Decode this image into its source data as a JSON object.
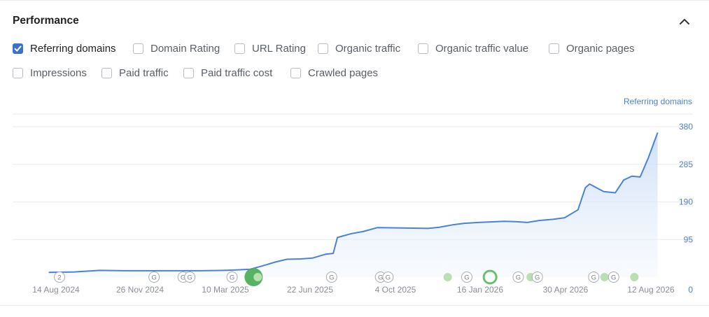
{
  "panel": {
    "title": "Performance"
  },
  "metrics": [
    {
      "label": "Referring domains",
      "checked": true
    },
    {
      "label": "Domain Rating",
      "checked": false
    },
    {
      "label": "URL Rating",
      "checked": false
    },
    {
      "label": "Organic traffic",
      "checked": false
    },
    {
      "label": "Organic traffic value",
      "checked": false
    },
    {
      "label": "Organic pages",
      "checked": false
    },
    {
      "label": "Impressions",
      "checked": false
    },
    {
      "label": "Paid traffic",
      "checked": false
    },
    {
      "label": "Paid traffic cost",
      "checked": false
    },
    {
      "label": "Crawled pages",
      "checked": false
    }
  ],
  "colors": {
    "line": "#4a82d6",
    "grid": "#e9ebef",
    "axis_text": "#8a8f98",
    "y_tick": "#4d7fd0",
    "marker_green": "#6cbf6c",
    "marker_light": "#b8e0b0"
  },
  "chart_data": {
    "type": "area",
    "title": "",
    "ylabel": "Referring domains",
    "ylim": [
      0,
      390
    ],
    "yticks": [
      0,
      95,
      190,
      285,
      380
    ],
    "xticks": [
      "14 Aug 2024",
      "26 Nov 2024",
      "10 Mar 2025",
      "22 Jun 2025",
      "4 Oct 2025",
      "16 Jan 2026",
      "30 Apr 2026",
      "12 Aug 2026"
    ],
    "x": [
      "2024-08-01",
      "2024-09-01",
      "2024-10-01",
      "2024-11-01",
      "2024-12-01",
      "2025-01-01",
      "2025-02-01",
      "2025-03-01",
      "2025-03-15",
      "2025-04-01",
      "2025-04-15",
      "2025-05-01",
      "2025-05-15",
      "2025-06-01",
      "2025-06-15",
      "2025-07-01",
      "2025-07-10",
      "2025-07-15",
      "2025-08-01",
      "2025-08-15",
      "2025-09-01",
      "2025-10-01",
      "2025-11-01",
      "2025-11-15",
      "2025-12-01",
      "2025-12-15",
      "2026-01-01",
      "2026-02-01",
      "2026-02-15",
      "2026-03-01",
      "2026-03-15",
      "2026-04-01",
      "2026-04-15",
      "2026-05-01",
      "2026-05-10",
      "2026-05-15",
      "2026-06-01",
      "2026-06-15",
      "2026-06-25",
      "2026-07-05",
      "2026-07-15",
      "2026-07-25",
      "2026-08-05"
    ],
    "series": [
      {
        "name": "Referring domains",
        "values": [
          12,
          13,
          17,
          16,
          16,
          16,
          16,
          17,
          18,
          20,
          28,
          38,
          45,
          46,
          48,
          58,
          60,
          100,
          110,
          115,
          125,
          124,
          123,
          126,
          132,
          136,
          138,
          141,
          140,
          138,
          143,
          146,
          150,
          170,
          226,
          235,
          216,
          213,
          245,
          255,
          253,
          302,
          365
        ]
      }
    ],
    "event_markers": [
      {
        "date": "2024-08-14",
        "label": "2"
      },
      {
        "date": "2024-12-06",
        "label": "G"
      },
      {
        "date": "2025-01-10",
        "label": "G"
      },
      {
        "date": "2025-01-18",
        "label": "G"
      },
      {
        "date": "2025-03-10",
        "label": "G"
      },
      {
        "date": "2025-07-08",
        "label": "G"
      },
      {
        "date": "2025-09-05",
        "label": "G"
      },
      {
        "date": "2025-09-14",
        "label": "G"
      },
      {
        "date": "2025-12-18",
        "label": "G"
      },
      {
        "date": "2026-02-18",
        "label": "G"
      },
      {
        "date": "2026-03-13",
        "label": "G"
      },
      {
        "date": "2026-05-20",
        "label": "G"
      },
      {
        "date": "2026-06-13",
        "label": "G"
      }
    ],
    "dot_markers": [
      {
        "date": "2025-04-05",
        "kind": "big"
      },
      {
        "date": "2025-04-10",
        "kind": "small"
      },
      {
        "date": "2025-11-25",
        "kind": "small"
      },
      {
        "date": "2026-01-15",
        "kind": "ring"
      },
      {
        "date": "2026-03-05",
        "kind": "small"
      },
      {
        "date": "2026-06-02",
        "kind": "small"
      },
      {
        "date": "2026-07-08",
        "kind": "small"
      }
    ]
  }
}
